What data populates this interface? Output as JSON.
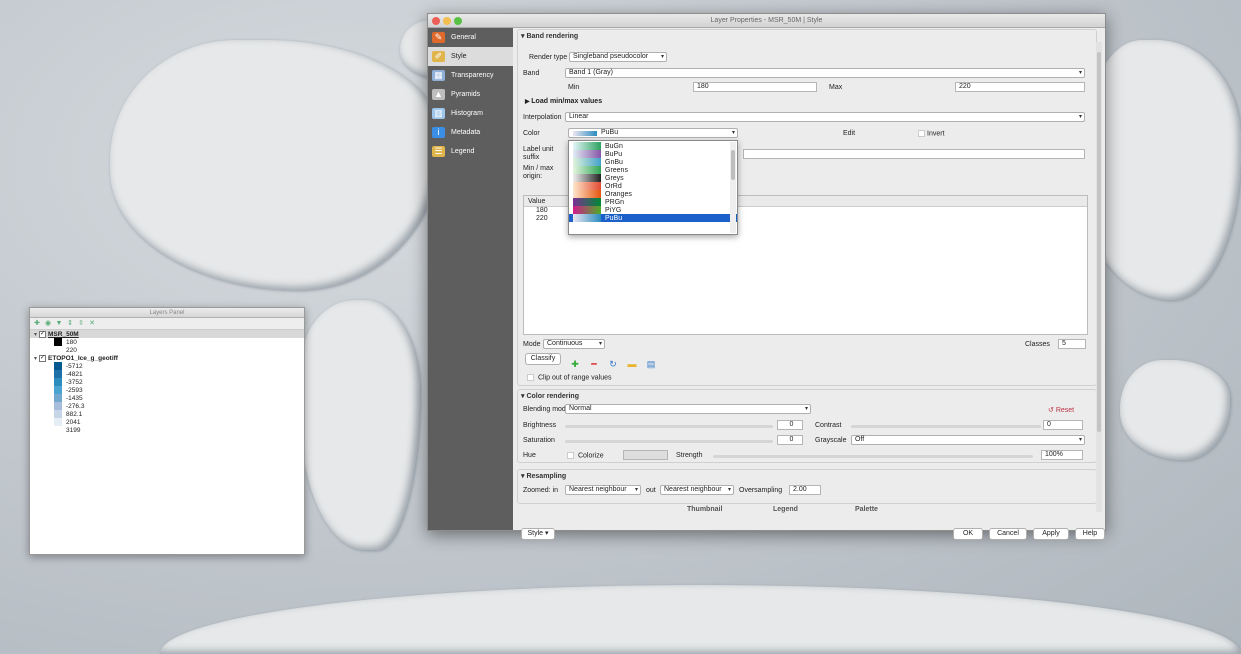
{
  "window_title": "Layer Properties - MSR_50M | Style",
  "layers_panel": {
    "title": "Layers Panel",
    "layers": [
      {
        "name": "MSR_50M",
        "legend": [
          {
            "label": "180",
            "color": "#000000"
          },
          {
            "label": "220",
            "color": "#ffffff"
          }
        ]
      },
      {
        "name": "ETOPO1_Ice_g_geotiff",
        "legend": [
          {
            "label": "-5712",
            "color": "#045a8d"
          },
          {
            "label": "-4821",
            "color": "#1f6fa8"
          },
          {
            "label": "-3752",
            "color": "#2b8cbe"
          },
          {
            "label": "-2593",
            "color": "#4aa3d1"
          },
          {
            "label": "-1435",
            "color": "#74a9cf"
          },
          {
            "label": "-276.3",
            "color": "#a6bddb"
          },
          {
            "label": "882.1",
            "color": "#c6d6e8"
          },
          {
            "label": "2041",
            "color": "#e5eef6"
          },
          {
            "label": "3199",
            "color": "#ffffff"
          }
        ]
      }
    ]
  },
  "sidebar": [
    {
      "label": "General",
      "icon": "wrench-icon",
      "color": "#e06a2c",
      "glyph": "✎"
    },
    {
      "label": "Style",
      "icon": "brush-icon",
      "color": "#e0b54c",
      "glyph": "✐"
    },
    {
      "label": "Transparency",
      "icon": "transparency-icon",
      "color": "#8fb0d8",
      "glyph": "▦"
    },
    {
      "label": "Pyramids",
      "icon": "pyramid-icon",
      "color": "#bdbdbd",
      "glyph": "▲"
    },
    {
      "label": "Histogram",
      "icon": "histogram-icon",
      "color": "#9ec5ea",
      "glyph": "▥"
    },
    {
      "label": "Metadata",
      "icon": "info-icon",
      "color": "#3a8ee6",
      "glyph": "i"
    },
    {
      "label": "Legend",
      "icon": "legend-icon",
      "color": "#e0b54c",
      "glyph": "☰"
    }
  ],
  "band_rendering": {
    "header": "Band rendering",
    "render_type_label": "Render type",
    "render_type": "Singleband pseudocolor",
    "band_label": "Band",
    "band": "Band 1 (Gray)",
    "min_label": "Min",
    "min": "180",
    "max_label": "Max",
    "max": "220",
    "load_minmax": "Load min/max values",
    "interpolation_label": "Interpolation",
    "interpolation": "Linear",
    "color_label": "Color",
    "color": "PuBu",
    "edit_label": "Edit",
    "invert_label": "Invert",
    "label_unit_suffix": "Label unit suffix",
    "minmax_origin": "Min / max origin:",
    "table_header": "Value",
    "table_rows": [
      "180",
      "220"
    ],
    "mode_label": "Mode",
    "mode": "Continuous",
    "classes_label": "Classes",
    "classes": "5",
    "classify": "Classify",
    "clip_label": "Clip out of range values"
  },
  "color_ramps": [
    {
      "name": "BuGn",
      "c1": "#e5f5f9",
      "c2": "#2ca25f"
    },
    {
      "name": "BuPu",
      "c1": "#e0ecf4",
      "c2": "#8856a7"
    },
    {
      "name": "GnBu",
      "c1": "#e0f3db",
      "c2": "#43a2ca"
    },
    {
      "name": "Greens",
      "c1": "#e5f5e0",
      "c2": "#31a354"
    },
    {
      "name": "Greys",
      "c1": "#f0f0f0",
      "c2": "#222222"
    },
    {
      "name": "OrRd",
      "c1": "#fee8c8",
      "c2": "#e34a33"
    },
    {
      "name": "Oranges",
      "c1": "#fee6ce",
      "c2": "#e6550d"
    },
    {
      "name": "PRGn",
      "c1": "#7b3294",
      "c2": "#008837"
    },
    {
      "name": "PiYG",
      "c1": "#d01c8b",
      "c2": "#4dac26"
    },
    {
      "name": "PuBu",
      "c1": "#ece7f2",
      "c2": "#2b8cbe"
    }
  ],
  "color_rendering": {
    "header": "Color rendering",
    "blending_label": "Blending mode",
    "blending": "Normal",
    "reset": "Reset",
    "brightness_label": "Brightness",
    "brightness": "0",
    "contrast_label": "Contrast",
    "contrast": "0",
    "saturation_label": "Saturation",
    "saturation": "0",
    "grayscale_label": "Grayscale",
    "grayscale": "Off",
    "hue_label": "Hue",
    "colorize_label": "Colorize",
    "strength_label": "Strength",
    "strength": "100%"
  },
  "resampling": {
    "header": "Resampling",
    "zoomed_in_label": "Zoomed: in",
    "zoomed_in": "Nearest neighbour",
    "out_label": "out",
    "out": "Nearest neighbour",
    "oversampling_label": "Oversampling",
    "oversampling": "2.00",
    "thumbnail": "Thumbnail",
    "legend": "Legend",
    "palette": "Palette"
  },
  "footer": {
    "style": "Style",
    "ok": "OK",
    "cancel": "Cancel",
    "apply": "Apply",
    "help": "Help"
  }
}
